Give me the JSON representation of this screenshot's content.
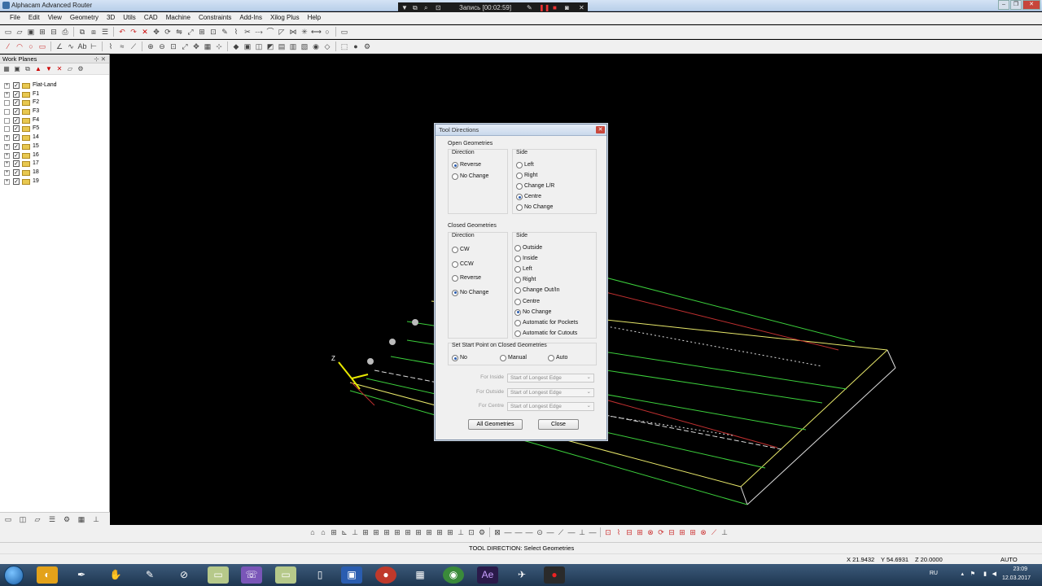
{
  "window": {
    "title": "Alphacam Advanced Router"
  },
  "recorder": {
    "label": "Запись [00:02:59]"
  },
  "menu": [
    "File",
    "Edit",
    "View",
    "Geometry",
    "3D",
    "Utils",
    "CAD",
    "Machine",
    "Constraints",
    "Add-Ins",
    "Xilog Plus",
    "Help"
  ],
  "left_panel": {
    "title": "Work Planes",
    "tree": [
      {
        "label": "Flat-Land",
        "expand": "+",
        "checked": "✓"
      },
      {
        "label": "F1",
        "expand": "+",
        "checked": "✓"
      },
      {
        "label": "F2",
        "expand": "",
        "checked": "✓"
      },
      {
        "label": "F3",
        "expand": "",
        "checked": "✓"
      },
      {
        "label": "F4",
        "expand": "",
        "checked": "✓"
      },
      {
        "label": "F5",
        "expand": "",
        "checked": "✓"
      },
      {
        "label": "14",
        "expand": "+",
        "checked": "✓"
      },
      {
        "label": "15",
        "expand": "+",
        "checked": "✓"
      },
      {
        "label": "16",
        "expand": "+",
        "checked": "✓"
      },
      {
        "label": "17",
        "expand": "+",
        "checked": "✓"
      },
      {
        "label": "18",
        "expand": "+",
        "checked": "✓"
      },
      {
        "label": "19",
        "expand": "+",
        "checked": "✓"
      }
    ]
  },
  "dialog": {
    "title": "Tool Directions",
    "open_geometries": {
      "label": "Open Geometries",
      "direction_label": "Direction",
      "direction_options": [
        "Reverse",
        "No Change"
      ],
      "direction_selected": "Reverse",
      "side_label": "Side",
      "side_options": [
        "Left",
        "Right",
        "Change L/R",
        "Centre",
        "No Change"
      ],
      "side_selected": "Centre"
    },
    "closed_geometries": {
      "label": "Closed Geometries",
      "direction_label": "Direction",
      "direction_options": [
        "CW",
        "CCW",
        "Reverse",
        "No Change"
      ],
      "direction_selected": "No Change",
      "side_label": "Side",
      "side_options": [
        "Outside",
        "Inside",
        "Left",
        "Right",
        "Change Out/In",
        "Centre",
        "No Change",
        "Automatic for Pockets",
        "Automatic for Cutouts"
      ],
      "side_selected": "No Change"
    },
    "start_point": {
      "label": "Set Start Point on Closed Geometries",
      "options": [
        "No",
        "Manual",
        "Auto"
      ],
      "selected": "No"
    },
    "fields": [
      {
        "label": "For Inside",
        "value": "Start of Longest Edge"
      },
      {
        "label": "For Outside",
        "value": "Start of Longest Edge"
      },
      {
        "label": "For Centre",
        "value": "Start of Longest Edge"
      }
    ],
    "buttons": {
      "all": "All Geometries",
      "close": "Close"
    }
  },
  "status": {
    "message": "TOOL DIRECTION: Select Geometries"
  },
  "coords": {
    "x": "X 21.9432",
    "y": "Y 54.6931",
    "z": "Z 20.0000",
    "mode": "AUTO"
  },
  "axis": {
    "z_label": "Z"
  },
  "taskbar": {
    "lang": "RU",
    "time": "23:09",
    "date": "12.03.2017"
  },
  "colors": {
    "geometry_yellow": "#e8e86a",
    "geometry_green": "#3ccf3c",
    "geometry_white": "#dddddd",
    "geometry_red": "#c03030"
  }
}
